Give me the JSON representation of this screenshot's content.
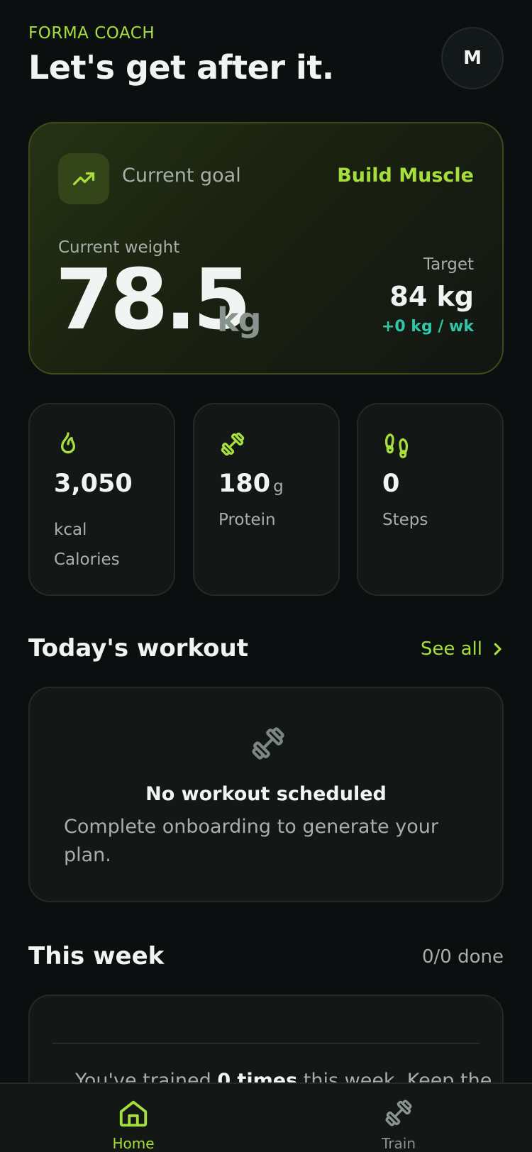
{
  "header": {
    "brand": "FORMA COACH",
    "greeting": "Let's get after it.",
    "avatar_initial": "M"
  },
  "goal_card": {
    "icon": "trending-up-icon",
    "label": "Current goal",
    "goal": "Build Muscle",
    "weight_label": "Current weight",
    "weight_value": "78.5",
    "weight_unit": "kg",
    "target_label": "Target",
    "target_value": "84 kg",
    "target_rate": "+0 kg / wk"
  },
  "stats": {
    "calories": {
      "icon": "flame-icon",
      "value": "3,050",
      "unit": "kcal",
      "label": "Calories"
    },
    "protein": {
      "icon": "dumbbell-icon",
      "value": "180",
      "unit": "g",
      "label": "Protein"
    },
    "steps": {
      "icon": "footprints-icon",
      "value": "0",
      "label": "Steps"
    }
  },
  "workout": {
    "section_title": "Today's workout",
    "see_all": "See all",
    "empty_icon": "dumbbell-icon",
    "empty_title": "No workout scheduled",
    "empty_desc": "Complete onboarding to generate your plan."
  },
  "week": {
    "section_title": "This week",
    "done": "0/0 done",
    "text_before": "You've trained ",
    "text_bold": "0 times",
    "text_after": " this week. Keep the"
  },
  "tabbar": {
    "tabs": [
      {
        "label": "Home",
        "icon": "home-icon",
        "active": true
      },
      {
        "label": "Train",
        "icon": "dumbbell-icon",
        "active": false
      }
    ]
  },
  "colors": {
    "background": "#0b0f0f",
    "accent": "#a6df3c",
    "teal": "#2fc7a7",
    "card": "#131817",
    "muted": "#a7afaa"
  }
}
